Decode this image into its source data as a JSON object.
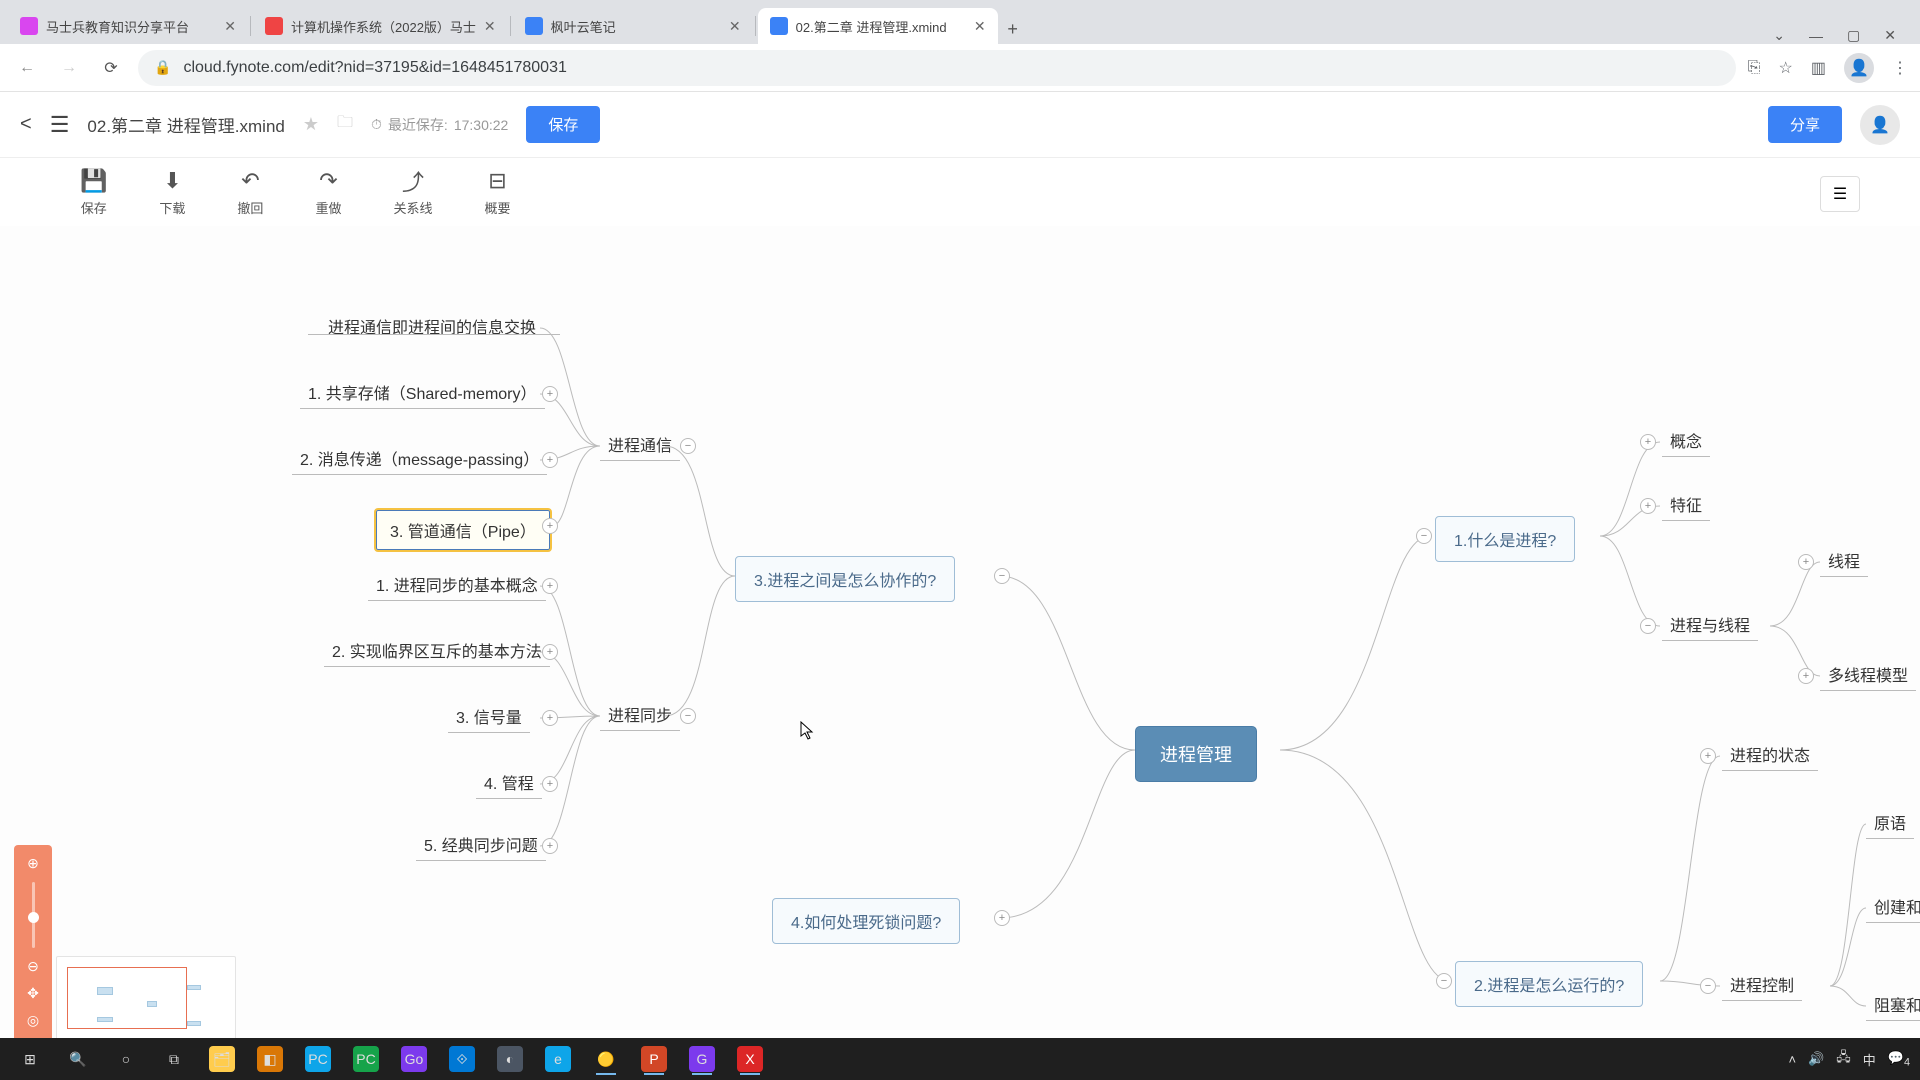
{
  "browser": {
    "tabs": [
      {
        "title": "马士兵教育知识分享平台",
        "favicon_color": "#d946ef"
      },
      {
        "title": "计算机操作系统（2022版）马士",
        "favicon_color": "#ef4444"
      },
      {
        "title": "枫叶云笔记",
        "favicon_color": "#3b82f6"
      },
      {
        "title": "02.第二章 进程管理.xmind",
        "favicon_color": "#3b82f6",
        "active": true
      }
    ],
    "url": "cloud.fynote.com/edit?nid=37195&id=1648451780031",
    "window_controls": {
      "min": "—",
      "max": "▢",
      "close": "✕",
      "dropdown": "⌄"
    }
  },
  "app": {
    "doc_title": "02.第二章 进程管理.xmind",
    "last_save_label": "最近保存:",
    "last_save_time": "17:30:22",
    "save_btn": "保存",
    "share_btn": "分享",
    "toolbar": [
      {
        "key": "save",
        "label": "保存",
        "icon": "💾"
      },
      {
        "key": "download",
        "label": "下载",
        "icon": "⬇"
      },
      {
        "key": "undo",
        "label": "撤回",
        "icon": "↶"
      },
      {
        "key": "redo",
        "label": "重做",
        "icon": "↷"
      },
      {
        "key": "relation",
        "label": "关系线",
        "icon": "⤴"
      },
      {
        "key": "summary",
        "label": "概要",
        "icon": "⊟"
      }
    ]
  },
  "mindmap": {
    "center": "进程管理",
    "branches": {
      "q1": {
        "label": "1.什么是进程?",
        "children": [
          "概念",
          "特征"
        ],
        "sub": {
          "label": "进程与线程",
          "children": [
            "线程",
            "多线程模型"
          ]
        }
      },
      "q2": {
        "label": "2.进程是怎么运行的?",
        "children": [
          "进程的状态"
        ],
        "sub": {
          "label": "进程控制",
          "children": [
            "原语",
            "创建和",
            "阻塞和"
          ]
        }
      },
      "q3": {
        "label": "3.进程之间是怎么协作的?",
        "comm": {
          "label": "进程通信",
          "intro": "进程通信即进程间的信息交换",
          "items": [
            "1. 共享存储（Shared-memory）",
            "2. 消息传递（message-passing）",
            "3. 管道通信（Pipe）"
          ]
        },
        "sync": {
          "label": "进程同步",
          "items": [
            "1. 进程同步的基本概念",
            "2. 实现临界区互斥的基本方法",
            "3. 信号量",
            "4. 管程",
            "5. 经典同步问题"
          ]
        }
      },
      "q4": {
        "label": "4.如何处理死锁问题?"
      }
    }
  },
  "taskbar": {
    "tray": {
      "ime": "中",
      "notif": "4"
    }
  }
}
